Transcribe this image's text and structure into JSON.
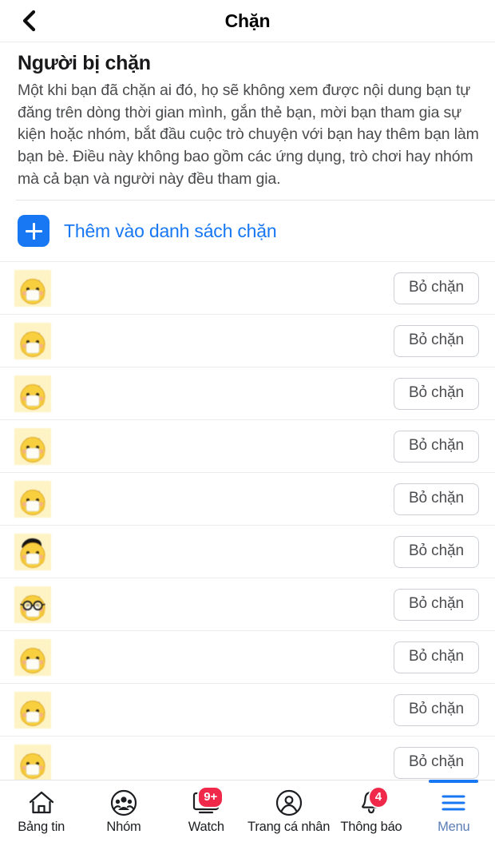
{
  "header": {
    "back_icon": "chevron-left-icon",
    "title": "Chặn"
  },
  "main": {
    "section_title": "Người bị chặn",
    "section_description": "Một khi bạn đã chặn ai đó, họ sẽ không xem được nội dung bạn tự đăng trên dòng thời gian mình, gắn thẻ bạn, mời bạn tham gia sự kiện hoặc nhóm, bắt đầu cuộc trò chuyện với bạn hay thêm bạn làm bạn bè. Điều này không bao gồm các ứng dụng, trò chơi hay nhóm mà cả bạn và người này đều tham gia.",
    "add_to_block_list": {
      "icon": "plus-square-icon",
      "label": "Thêm vào danh sách chặn",
      "accent_color": "#1877f2"
    },
    "unblock_label": "Bỏ chặn",
    "blocked_people": [
      {
        "name": "",
        "avatar": "duck-mask-avatar"
      },
      {
        "name": "",
        "avatar": "duck-mask-avatar"
      },
      {
        "name": "",
        "avatar": "duck-mask-avatar"
      },
      {
        "name": "",
        "avatar": "duck-mask-avatar"
      },
      {
        "name": "",
        "avatar": "duck-mask-avatar"
      },
      {
        "name": "",
        "avatar": "duck-black-hair-avatar"
      },
      {
        "name": "",
        "avatar": "duck-glasses-avatar"
      },
      {
        "name": "",
        "avatar": "duck-mask-avatar"
      },
      {
        "name": "",
        "avatar": "duck-mask-avatar"
      },
      {
        "name": "",
        "avatar": "duck-mask-avatar"
      }
    ]
  },
  "tabbar": {
    "active_tab": "menu",
    "accent_color": "#1877f2",
    "badge_color": "#f02849",
    "tabs": [
      {
        "id": "news",
        "label": "Bảng tin",
        "icon": "home-icon",
        "badge": ""
      },
      {
        "id": "groups",
        "label": "Nhóm",
        "icon": "groups-icon",
        "badge": ""
      },
      {
        "id": "watch",
        "label": "Watch",
        "icon": "watch-icon",
        "badge": "9+"
      },
      {
        "id": "profile",
        "label": "Trang cá nhân",
        "icon": "profile-icon",
        "badge": ""
      },
      {
        "id": "notifs",
        "label": "Thông báo",
        "icon": "bell-icon",
        "badge": "4"
      },
      {
        "id": "menu",
        "label": "Menu",
        "icon": "hamburger-icon",
        "badge": ""
      }
    ]
  }
}
